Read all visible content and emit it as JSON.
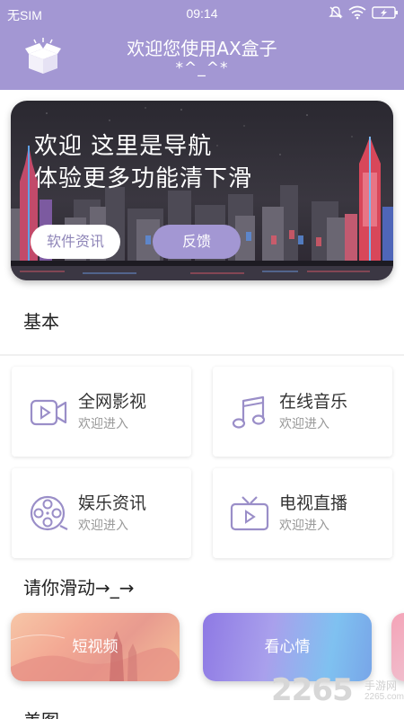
{
  "status_bar": {
    "carrier": "无SIM",
    "time": "09:14"
  },
  "header": {
    "title": "欢迎您使用AX盒子",
    "subtitle": "*^_^*"
  },
  "banner": {
    "line1": "欢迎 这里是导航",
    "line2": "体验更多功能清下滑",
    "info_button": "软件资讯",
    "feedback_button": "反馈"
  },
  "sections": {
    "basic": "基本",
    "scroll_hint": "请你滑动→_→",
    "pictures": "美图"
  },
  "cards": [
    {
      "title": "全网影视",
      "subtitle": "欢迎进入",
      "icon": "video-camera-icon"
    },
    {
      "title": "在线音乐",
      "subtitle": "欢迎进入",
      "icon": "music-note-icon"
    },
    {
      "title": "娱乐资讯",
      "subtitle": "欢迎进入",
      "icon": "film-reel-icon"
    },
    {
      "title": "电视直播",
      "subtitle": "欢迎进入",
      "icon": "tv-icon"
    }
  ],
  "scroll_cards": [
    {
      "label": "短视频"
    },
    {
      "label": "看心情"
    }
  ],
  "watermark": {
    "number": "2265",
    "suffix": "手游网",
    "url": "2265.com"
  },
  "colors": {
    "accent": "#a397d3",
    "icon": "#9a8ec8"
  }
}
